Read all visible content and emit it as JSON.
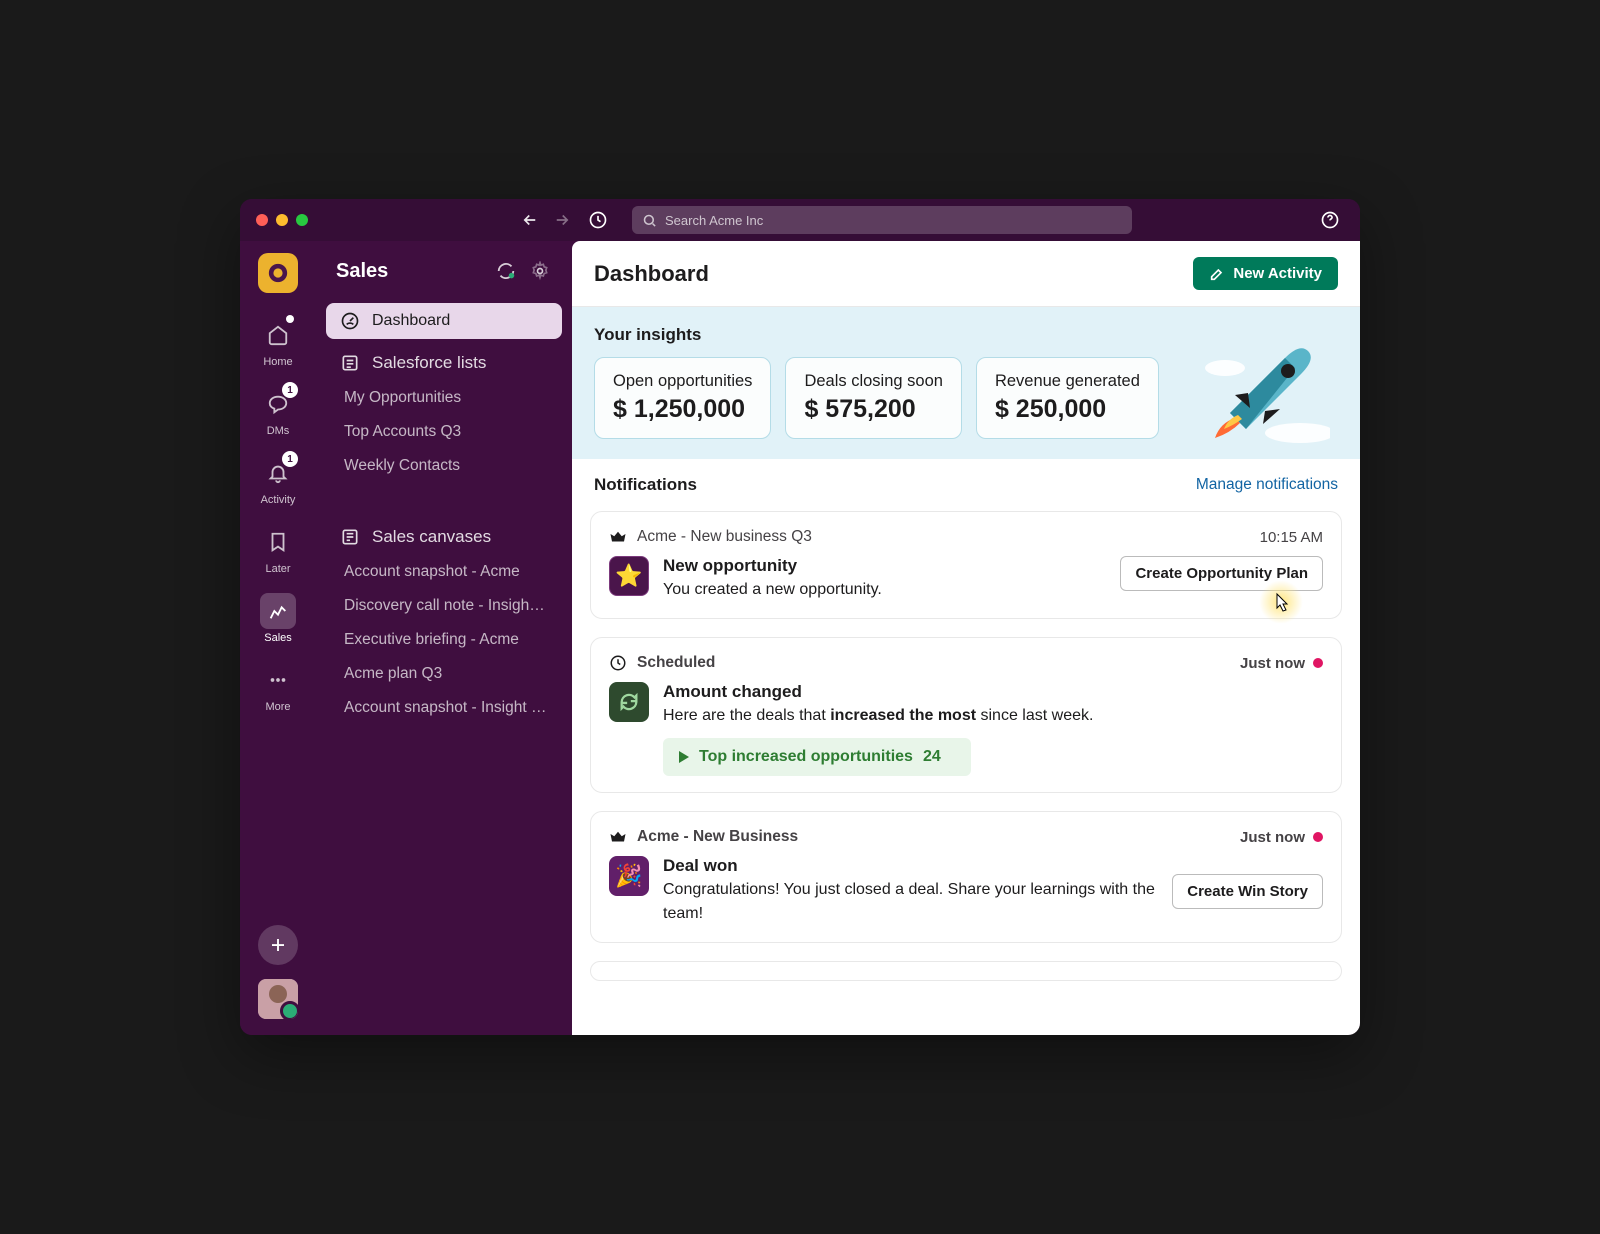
{
  "search": {
    "placeholder": "Search Acme Inc"
  },
  "rail": {
    "items": [
      {
        "key": "home",
        "label": "Home"
      },
      {
        "key": "dms",
        "label": "DMs",
        "badge": "1"
      },
      {
        "key": "activity",
        "label": "Activity",
        "badge": "1"
      },
      {
        "key": "later",
        "label": "Later"
      },
      {
        "key": "sales",
        "label": "Sales"
      },
      {
        "key": "more",
        "label": "More"
      }
    ]
  },
  "sidebar": {
    "title": "Sales",
    "nav": {
      "dashboard": "Dashboard"
    },
    "section1": {
      "title": "Salesforce lists",
      "items": [
        "My Opportunities",
        "Top Accounts Q3",
        "Weekly Contacts"
      ]
    },
    "section2": {
      "title": "Sales canvases",
      "items": [
        "Account snapshot - Acme",
        "Discovery call note - Insights lab",
        "Executive briefing - Acme",
        "Acme plan Q3",
        "Account snapshot - Insight lab r..."
      ]
    }
  },
  "main": {
    "title": "Dashboard",
    "new_activity": "New Activity",
    "insights": {
      "title": "Your insights",
      "cards": [
        {
          "label": "Open opportunities",
          "value": "$ 1,250,000"
        },
        {
          "label": "Deals closing soon",
          "value": "$ 575,200"
        },
        {
          "label": "Revenue generated",
          "value": "$ 250,000"
        }
      ]
    },
    "notifications": {
      "title": "Notifications",
      "manage": "Manage notifications",
      "items": [
        {
          "channel": "Acme - New business Q3",
          "time": "10:15 AM",
          "title": "New opportunity",
          "desc_pre": "You created a new opportunity.",
          "button": "Create Opportunity Plan",
          "icon": "star",
          "unread": false,
          "header_icon": "crown"
        },
        {
          "channel": "Scheduled",
          "time": "Just now",
          "title": "Amount changed",
          "desc_pre": "Here are the deals that ",
          "desc_bold": "increased the most",
          "desc_post": " since last week.",
          "pill_label": "Top increased opportunities",
          "pill_count": "24",
          "icon": "refresh",
          "unread": true,
          "header_icon": "clock"
        },
        {
          "channel": "Acme - New Business",
          "time": "Just now",
          "title": "Deal won",
          "desc_pre": "Congratulations! You just closed a deal. Share your learnings with the team!",
          "button": "Create Win Story",
          "icon": "party",
          "unread": true,
          "header_icon": "crown"
        }
      ]
    }
  }
}
